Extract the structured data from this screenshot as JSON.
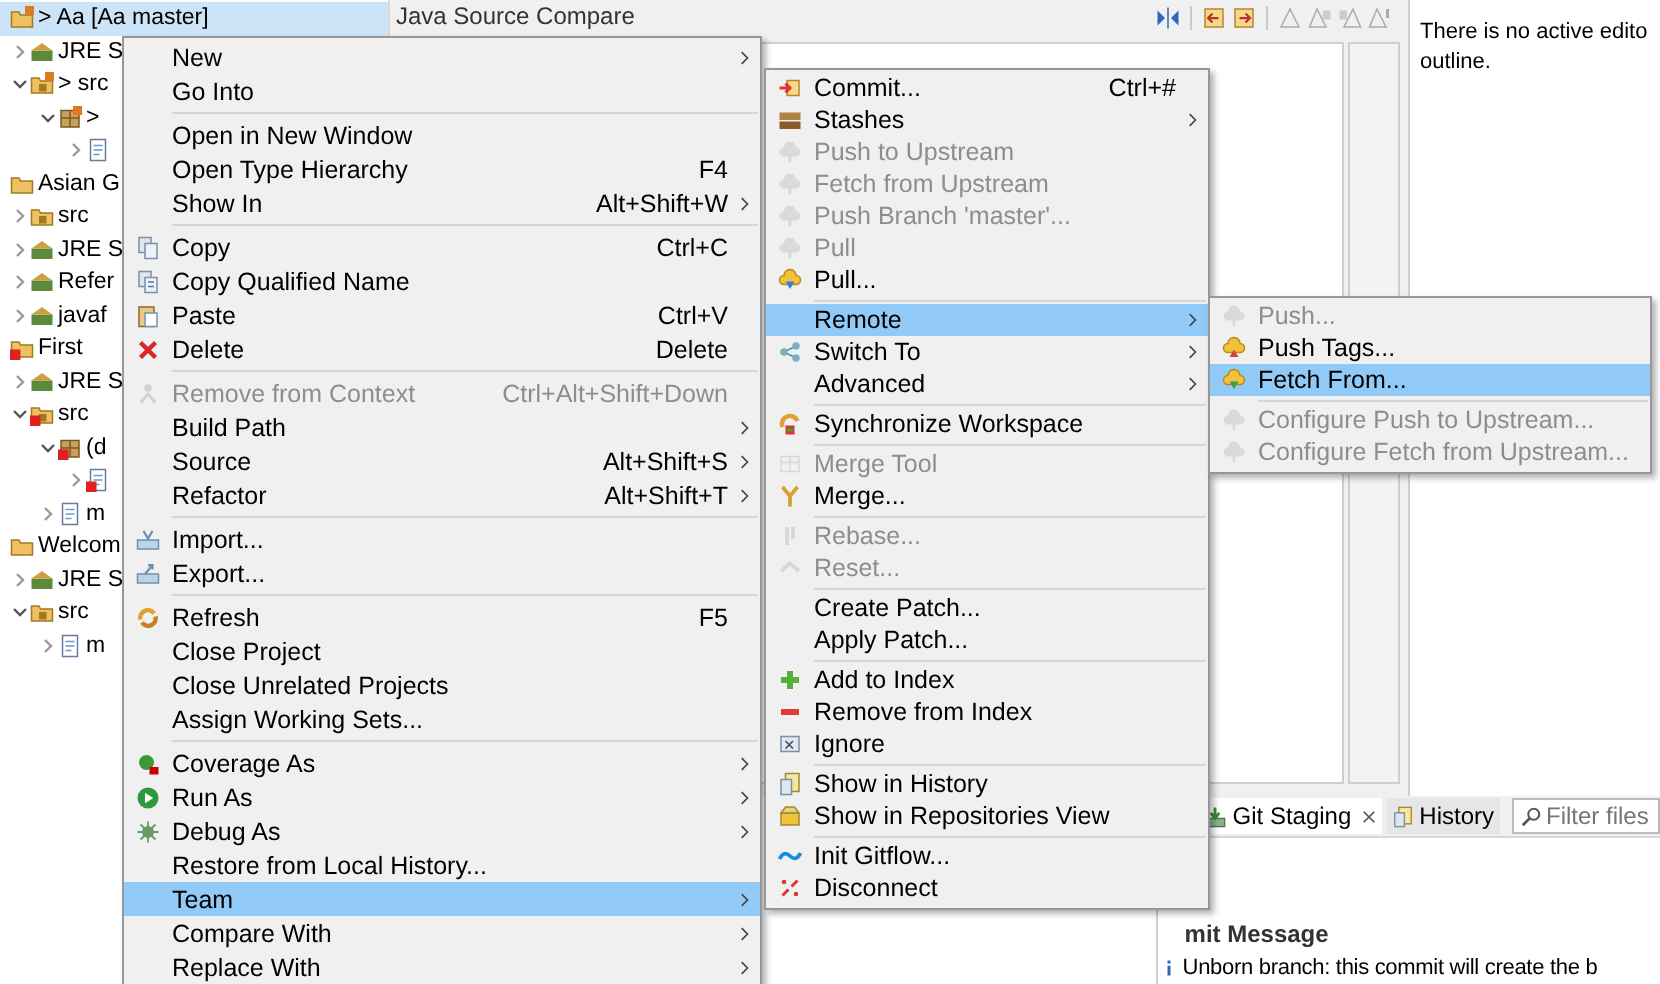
{
  "package_explorer": {
    "tree": [
      {
        "label": "> Aa [Aa master]",
        "selected": true,
        "children": [
          {
            "label": "JRE S",
            "expanded": false,
            "selected": false
          },
          {
            "label": "> src",
            "expanded": true,
            "selected": false,
            "children": [
              {
                "label": ">",
                "expanded": true,
                "selected": false,
                "children": [
                  {
                    "expanded": false,
                    "selected": false
                  }
                ]
              }
            ]
          }
        ]
      },
      {
        "label": "Asian G",
        "selected": false,
        "children": [
          {
            "label": "src",
            "expanded": false,
            "selected": false
          },
          {
            "label": "JRE S",
            "expanded": false,
            "selected": false
          },
          {
            "label": "Refer",
            "expanded": false,
            "selected": false
          },
          {
            "label": "javaf",
            "expanded": false,
            "selected": false
          }
        ]
      },
      {
        "label": "First",
        "selected": false,
        "children": [
          {
            "label": "JRE S",
            "expanded": false,
            "selected": false
          },
          {
            "label": "src",
            "expanded": true,
            "selected": false,
            "children": [
              {
                "label": "(d",
                "expanded": true,
                "selected": false,
                "children": [
                  {
                    "expanded": false,
                    "selected": false
                  }
                ]
              },
              {
                "label": "m",
                "expanded": false,
                "selected": false
              }
            ]
          }
        ]
      },
      {
        "label": "Welcom",
        "selected": false,
        "children": [
          {
            "label": "JRE S",
            "expanded": false,
            "selected": false
          },
          {
            "label": "src",
            "expanded": true,
            "selected": false,
            "children": [
              {
                "label": "m",
                "expanded": false,
                "selected": false
              }
            ]
          }
        ]
      }
    ]
  },
  "compare_editor": {
    "title": "Java Source Compare"
  },
  "outline": {
    "message_lines": [
      "There is no active edito",
      "outline."
    ]
  },
  "staging_view": {
    "tabs": [
      {
        "label": "Git Staging",
        "selected": true,
        "closable": true
      },
      {
        "label": "History",
        "selected": false,
        "closable": false
      }
    ],
    "filter": {
      "placeholder": "Filter files"
    },
    "commit_message_heading": "mit Message",
    "notice": "Unborn branch: this commit will create the b"
  },
  "context_menu": {
    "items": [
      {
        "kind": "item",
        "label": "New",
        "submenu": true,
        "selected": false,
        "disabled": false
      },
      {
        "kind": "item",
        "label": "Go Into",
        "submenu": false,
        "selected": false,
        "disabled": false
      },
      {
        "kind": "separator"
      },
      {
        "kind": "item",
        "label": "Open in New Window",
        "submenu": false,
        "selected": false,
        "disabled": false
      },
      {
        "kind": "item",
        "label": "Open Type Hierarchy",
        "shortcut": "F4",
        "submenu": false,
        "selected": false,
        "disabled": false
      },
      {
        "kind": "item",
        "label": "Show In",
        "shortcut": "Alt+Shift+W",
        "submenu": true,
        "selected": false,
        "disabled": false
      },
      {
        "kind": "separator"
      },
      {
        "kind": "item",
        "label": "Copy",
        "shortcut": "Ctrl+C",
        "submenu": false,
        "selected": false,
        "disabled": false
      },
      {
        "kind": "item",
        "label": "Copy Qualified Name",
        "submenu": false,
        "selected": false,
        "disabled": false
      },
      {
        "kind": "item",
        "label": "Paste",
        "shortcut": "Ctrl+V",
        "submenu": false,
        "selected": false,
        "disabled": false
      },
      {
        "kind": "item",
        "label": "Delete",
        "shortcut": "Delete",
        "submenu": false,
        "selected": false,
        "disabled": false
      },
      {
        "kind": "separator"
      },
      {
        "kind": "item",
        "label": "Remove from Context",
        "shortcut": "Ctrl+Alt+Shift+Down",
        "submenu": false,
        "selected": false,
        "disabled": true
      },
      {
        "kind": "item",
        "label": "Build Path",
        "submenu": true,
        "selected": false,
        "disabled": false
      },
      {
        "kind": "item",
        "label": "Source",
        "shortcut": "Alt+Shift+S",
        "submenu": true,
        "selected": false,
        "disabled": false
      },
      {
        "kind": "item",
        "label": "Refactor",
        "shortcut": "Alt+Shift+T",
        "submenu": true,
        "selected": false,
        "disabled": false
      },
      {
        "kind": "separator"
      },
      {
        "kind": "item",
        "label": "Import...",
        "submenu": false,
        "selected": false,
        "disabled": false
      },
      {
        "kind": "item",
        "label": "Export...",
        "submenu": false,
        "selected": false,
        "disabled": false
      },
      {
        "kind": "separator"
      },
      {
        "kind": "item",
        "label": "Refresh",
        "shortcut": "F5",
        "submenu": false,
        "selected": false,
        "disabled": false
      },
      {
        "kind": "item",
        "label": "Close Project",
        "submenu": false,
        "selected": false,
        "disabled": false
      },
      {
        "kind": "item",
        "label": "Close Unrelated Projects",
        "submenu": false,
        "selected": false,
        "disabled": false
      },
      {
        "kind": "item",
        "label": "Assign Working Sets...",
        "submenu": false,
        "selected": false,
        "disabled": false
      },
      {
        "kind": "separator"
      },
      {
        "kind": "item",
        "label": "Coverage As",
        "submenu": true,
        "selected": false,
        "disabled": false
      },
      {
        "kind": "item",
        "label": "Run As",
        "submenu": true,
        "selected": false,
        "disabled": false
      },
      {
        "kind": "item",
        "label": "Debug As",
        "submenu": true,
        "selected": false,
        "disabled": false
      },
      {
        "kind": "item",
        "label": "Restore from Local History...",
        "submenu": false,
        "selected": false,
        "disabled": false
      },
      {
        "kind": "item",
        "label": "Team",
        "submenu": true,
        "selected": true,
        "disabled": false
      },
      {
        "kind": "item",
        "label": "Compare With",
        "submenu": true,
        "selected": false,
        "disabled": false
      },
      {
        "kind": "item",
        "label": "Replace With",
        "submenu": true,
        "selected": false,
        "disabled": false
      }
    ]
  },
  "team_menu": {
    "items": [
      {
        "kind": "item",
        "label": "Commit...",
        "shortcut": "Ctrl+#",
        "submenu": false,
        "selected": false,
        "disabled": false
      },
      {
        "kind": "item",
        "label": "Stashes",
        "submenu": true,
        "selected": false,
        "disabled": false
      },
      {
        "kind": "item",
        "label": "Push to Upstream",
        "submenu": false,
        "selected": false,
        "disabled": true
      },
      {
        "kind": "item",
        "label": "Fetch from Upstream",
        "submenu": false,
        "selected": false,
        "disabled": true
      },
      {
        "kind": "item",
        "label": "Push Branch 'master'...",
        "submenu": false,
        "selected": false,
        "disabled": true
      },
      {
        "kind": "item",
        "label": "Pull",
        "submenu": false,
        "selected": false,
        "disabled": true
      },
      {
        "kind": "item",
        "label": "Pull...",
        "submenu": false,
        "selected": false,
        "disabled": false
      },
      {
        "kind": "separator"
      },
      {
        "kind": "item",
        "label": "Remote",
        "submenu": true,
        "selected": true,
        "disabled": false
      },
      {
        "kind": "item",
        "label": "Switch To",
        "submenu": true,
        "selected": false,
        "disabled": false
      },
      {
        "kind": "item",
        "label": "Advanced",
        "submenu": true,
        "selected": false,
        "disabled": false
      },
      {
        "kind": "separator"
      },
      {
        "kind": "item",
        "label": "Synchronize Workspace",
        "submenu": false,
        "selected": false,
        "disabled": false
      },
      {
        "kind": "separator"
      },
      {
        "kind": "item",
        "label": "Merge Tool",
        "submenu": false,
        "selected": false,
        "disabled": true
      },
      {
        "kind": "item",
        "label": "Merge...",
        "submenu": false,
        "selected": false,
        "disabled": false
      },
      {
        "kind": "separator"
      },
      {
        "kind": "item",
        "label": "Rebase...",
        "submenu": false,
        "selected": false,
        "disabled": true
      },
      {
        "kind": "item",
        "label": "Reset...",
        "submenu": false,
        "selected": false,
        "disabled": true
      },
      {
        "kind": "separator"
      },
      {
        "kind": "item",
        "label": "Create Patch...",
        "submenu": false,
        "selected": false,
        "disabled": false
      },
      {
        "kind": "item",
        "label": "Apply Patch...",
        "submenu": false,
        "selected": false,
        "disabled": false
      },
      {
        "kind": "separator"
      },
      {
        "kind": "item",
        "label": "Add to Index",
        "submenu": false,
        "selected": false,
        "disabled": false
      },
      {
        "kind": "item",
        "label": "Remove from Index",
        "submenu": false,
        "selected": false,
        "disabled": false
      },
      {
        "kind": "item",
        "label": "Ignore",
        "submenu": false,
        "selected": false,
        "disabled": false
      },
      {
        "kind": "separator"
      },
      {
        "kind": "item",
        "label": "Show in History",
        "submenu": false,
        "selected": false,
        "disabled": false
      },
      {
        "kind": "item",
        "label": "Show in Repositories View",
        "submenu": false,
        "selected": false,
        "disabled": false
      },
      {
        "kind": "separator"
      },
      {
        "kind": "item",
        "label": "Init Gitflow...",
        "submenu": false,
        "selected": false,
        "disabled": false
      },
      {
        "kind": "item",
        "label": "Disconnect",
        "submenu": false,
        "selected": false,
        "disabled": false
      }
    ]
  },
  "remote_menu": {
    "items": [
      {
        "kind": "item",
        "label": "Push...",
        "submenu": false,
        "selected": false,
        "disabled": true
      },
      {
        "kind": "item",
        "label": "Push Tags...",
        "submenu": false,
        "selected": false,
        "disabled": false
      },
      {
        "kind": "item",
        "label": "Fetch From...",
        "submenu": false,
        "selected": true,
        "disabled": false
      },
      {
        "kind": "separator"
      },
      {
        "kind": "item",
        "label": "Configure Push to Upstream...",
        "submenu": false,
        "selected": false,
        "disabled": true
      },
      {
        "kind": "item",
        "label": "Configure Fetch from Upstream...",
        "submenu": false,
        "selected": false,
        "disabled": true
      }
    ]
  }
}
